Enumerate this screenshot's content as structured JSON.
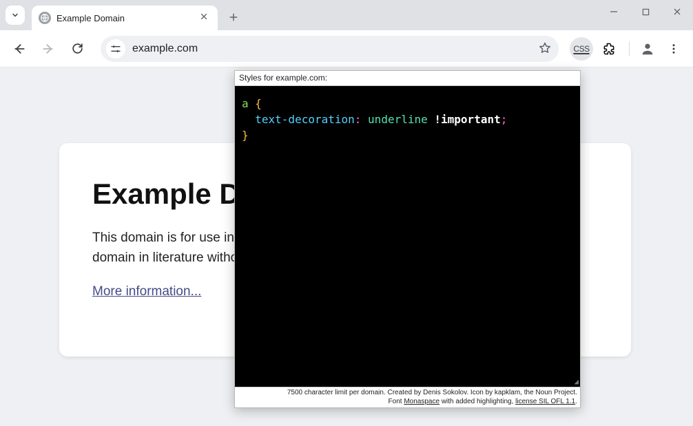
{
  "tab": {
    "title": "Example Domain"
  },
  "omnibox": {
    "url": "example.com"
  },
  "ext_css_label": "CSS",
  "page": {
    "heading": "Example Domain",
    "paragraph": "This domain is for use in illustrative examples in documents. You may use this domain in literature without prior coordination or asking for permission.",
    "link_text": "More information..."
  },
  "popup": {
    "header": "Styles for example.com:",
    "code": {
      "selector": "a",
      "property": "text-decoration",
      "value": "underline",
      "bang": "!important"
    },
    "footer_line1": "7500 character limit per domain. Created by Denis Sokolov. Icon by kapklam, the Noun Project.",
    "footer_line2_a": "Font ",
    "footer_line2_b": "Monaspace",
    "footer_line2_c": " with added highlighting, ",
    "footer_line2_d": "license SIL OFL 1.1",
    "footer_line2_e": "."
  }
}
